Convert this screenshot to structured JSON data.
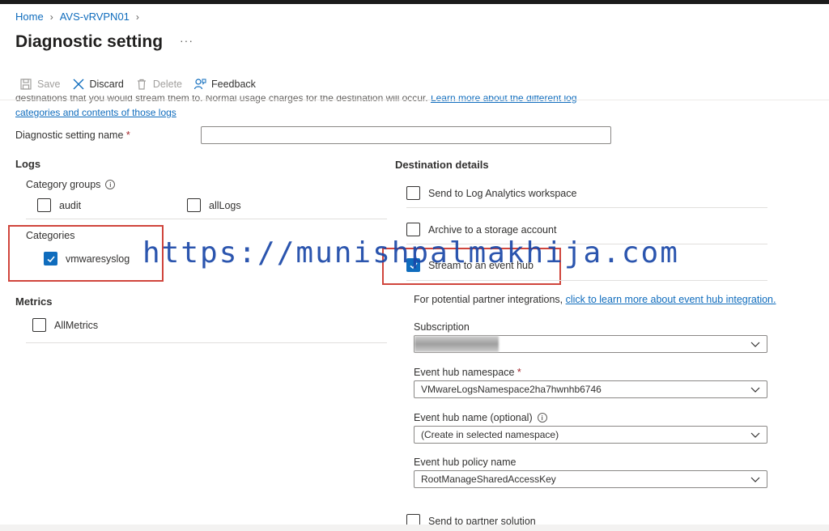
{
  "breadcrumb": {
    "home": "Home",
    "resource": "AVS-vRVPN01"
  },
  "page": {
    "title": "Diagnostic setting",
    "more": "···"
  },
  "toolbar": {
    "save": "Save",
    "discard": "Discard",
    "delete": "Delete",
    "feedback": "Feedback"
  },
  "description": {
    "line1_text": "destinations that you would stream them to. Normal usage charges for the destination will occur. ",
    "line1_link": "Learn more about the different log",
    "line2_link": "categories and contents of those logs"
  },
  "setting_name": {
    "label": "Diagnostic setting name",
    "required": "*",
    "value": ""
  },
  "logs": {
    "heading": "Logs",
    "category_groups_label": "Category groups",
    "groups": [
      {
        "label": "audit",
        "checked": false
      },
      {
        "label": "allLogs",
        "checked": false
      }
    ],
    "categories_label": "Categories",
    "categories": [
      {
        "label": "vmwaresyslog",
        "checked": true
      }
    ]
  },
  "metrics": {
    "heading": "Metrics",
    "items": [
      {
        "label": "AllMetrics",
        "checked": false
      }
    ]
  },
  "destination": {
    "heading": "Destination details",
    "log_analytics": "Send to Log Analytics workspace",
    "storage": "Archive to a storage account",
    "event_hub": "Stream to an event hub",
    "partner_text": "For potential partner integrations, ",
    "partner_link": "click to learn more about event hub integration.",
    "subscription_label": "Subscription",
    "subscription_value": "",
    "namespace_label": "Event hub namespace",
    "namespace_required": "*",
    "namespace_value": "VMwareLogsNamespace2ha7hwnhb6746",
    "hub_name_label": "Event hub name (optional)",
    "hub_name_value": "(Create in selected namespace)",
    "policy_label": "Event hub policy name",
    "policy_value": "RootManageSharedAccessKey",
    "partner_solution": "Send to partner solution"
  },
  "watermark": "https://munishpalmakhija.com",
  "colors": {
    "accent": "#0f6cbd",
    "highlight": "#d0453c"
  }
}
